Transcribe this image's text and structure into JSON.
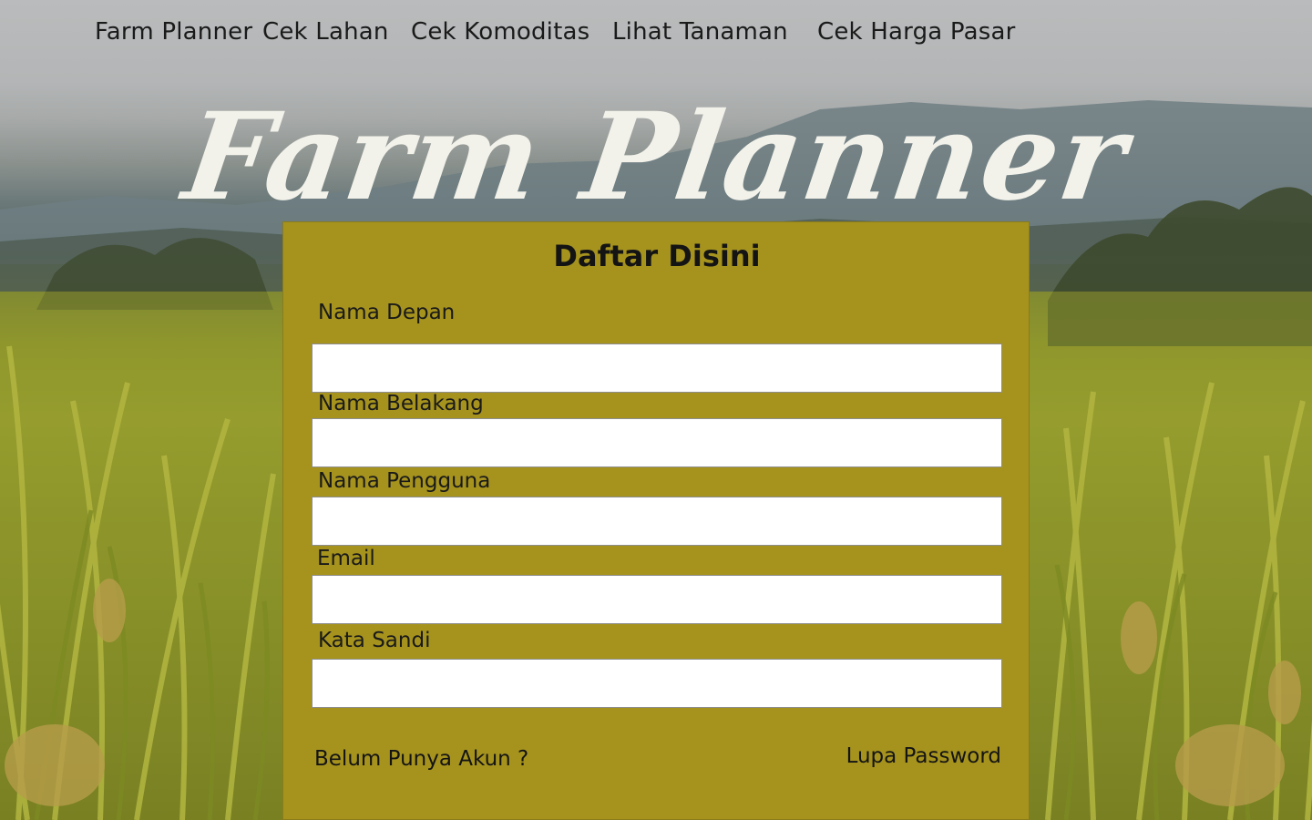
{
  "nav": {
    "items": [
      {
        "label": "Farm Planner"
      },
      {
        "label": "Cek Lahan"
      },
      {
        "label": "Cek Komoditas"
      },
      {
        "label": "Lihat Tanaman"
      },
      {
        "label": "Cek Harga Pasar"
      }
    ]
  },
  "hero": {
    "title": "Farm Planner"
  },
  "form": {
    "title": "Daftar Disini",
    "fields": [
      {
        "label": "Nama Depan",
        "value": ""
      },
      {
        "label": "Nama Belakang",
        "value": ""
      },
      {
        "label": "Nama Pengguna",
        "value": ""
      },
      {
        "label": "Email",
        "value": ""
      },
      {
        "label": "Kata Sandi",
        "value": ""
      }
    ],
    "register_link": "Belum Punya Akun ?",
    "forgot_link": "Lupa Password"
  },
  "colors": {
    "card_bg": "#a6931e",
    "hero_text": "#f2f2ea",
    "text": "#141414"
  }
}
